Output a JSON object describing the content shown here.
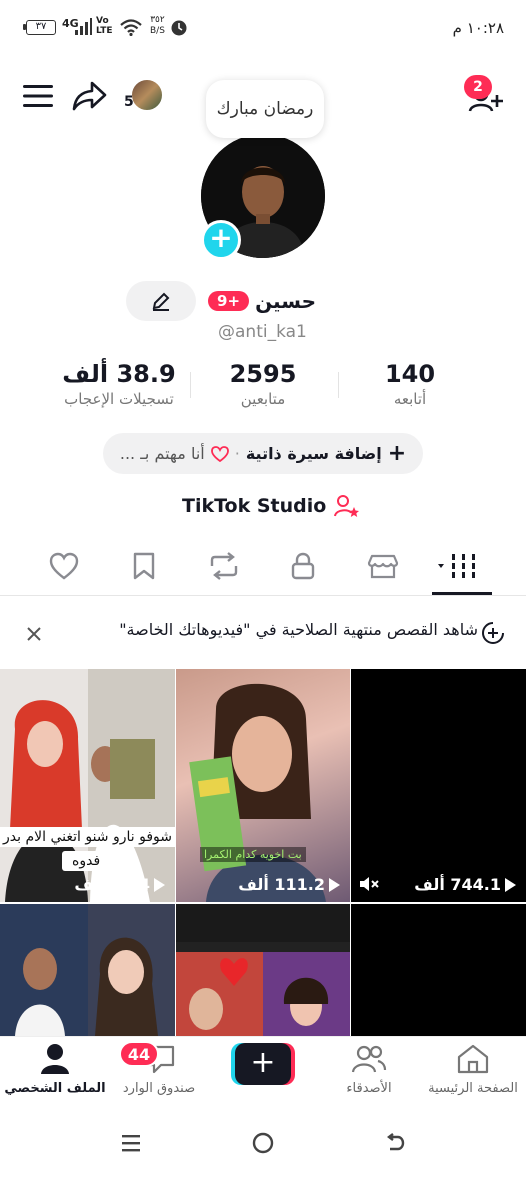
{
  "status_bar": {
    "time": "١٠:٢٨ م",
    "battery": "٣٧",
    "network": "4G",
    "volte": "Vo\nLTE",
    "speed_value": "٣٥٢",
    "speed_unit": "B/S"
  },
  "header": {
    "follower_requests_count": "2",
    "friends_count": "5"
  },
  "profile": {
    "bubble_text": "رمضان مبارك",
    "display_name": "حسين",
    "name_badge": "9+",
    "username": "@anti_ka1"
  },
  "stats": [
    {
      "value": "140",
      "label": "أتابعه"
    },
    {
      "value": "2595",
      "label": "متابعين"
    },
    {
      "value": "38.9 ألف",
      "label": "تسجيلات الإعجاب"
    }
  ],
  "bio_pill": {
    "add_bio": "إضافة سيرة ذاتية",
    "separator": "·",
    "interested": "أنا مهتم بـ ..."
  },
  "studio_label": "TikTok Studio",
  "banner": {
    "text": "شاهد القصص منتهية الصلاحية في \"فيديوهاتك الخاصة\""
  },
  "videos": [
    {
      "views": "744.1 ألف",
      "caption": ""
    },
    {
      "views": "111.2 ألف",
      "caption": "بت اخويه كدام الكمرا"
    },
    {
      "views": "35.4 ألف",
      "caption": "شوفو نارو شنو اتغني الام بدر",
      "caption2": "فدوه"
    }
  ],
  "bottom_nav": {
    "home": "الصفحة الرئيسية",
    "friends": "الأصدقاء",
    "inbox": "صندوق الوارد",
    "inbox_badge": "44",
    "profile": "الملف الشخصي"
  },
  "colors": {
    "accent": "#fe2c55",
    "cyan": "#20d5ec",
    "text": "#161823",
    "muted": "#777777"
  }
}
